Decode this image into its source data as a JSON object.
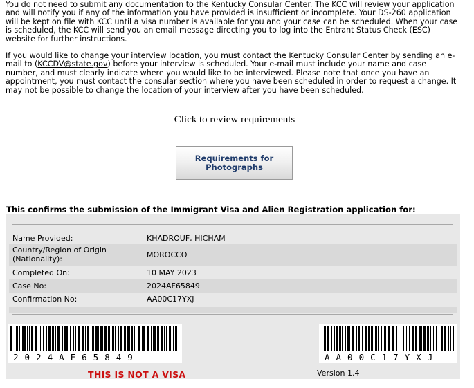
{
  "intro": {
    "paragraph1": "You do not need to submit any documentation to the Kentucky Consular Center. The KCC will review your application and will notify you if any of the information you have provided is insufficient or incomplete. Your DS-260 application will be kept on file with KCC until a visa number is available for you and your case can be scheduled. When your case is scheduled, the KCC will send you an email message directing you to log into the Entrant Status Check (ESC) website for further instructions.",
    "paragraph2_before": "If you would like to change your interview location, you must contact the Kentucky Consular Center by sending an e-mail to (",
    "email_link": "KCCDV@state.gov",
    "paragraph2_after": ") before your interview is scheduled. Your e-mail must include your name and case number, and must clearly indicate where you would like to be interviewed. Please note that once you have an appointment, you must contact the consular section where you have been scheduled in order to request a change. It may not be possible to change the location of your interview after you have been scheduled."
  },
  "review_text": "Click to review requirements",
  "requirements_button": "Requirements for Photographs",
  "confirmation_heading": "This confirms the submission of the Immigrant Visa and Alien Registration application for:",
  "details": {
    "name_label": "Name Provided:",
    "name_value": "KHADROUF, HICHAM",
    "country_label": "Country/Region of Origin (Nationality):",
    "country_value": "MOROCCO",
    "completed_label": "Completed On:",
    "completed_value": "10 MAY 2023",
    "case_label": "Case No:",
    "case_value": "2024AF65849",
    "confirmation_label": "Confirmation No:",
    "confirmation_value": "AA00C17YXJ"
  },
  "barcode_left_text": "2024AF65849",
  "barcode_right_text": "AA00C17YXJ",
  "not_visa_text": "THIS IS NOT A VISA",
  "version_text": "Version 1.4",
  "colors": {
    "warning_red": "#cc1111",
    "button_text": "#1f3b6b",
    "panel_bg": "#e8e8e8",
    "row_shade": "#d9d9d9"
  }
}
